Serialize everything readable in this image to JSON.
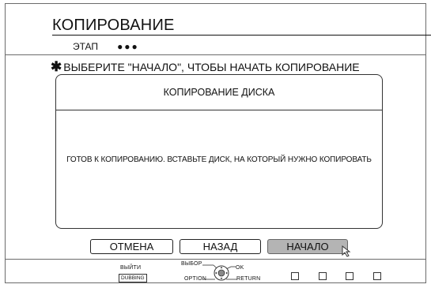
{
  "screen": {
    "title": "КОПИРОВАНИЕ",
    "step_label": "ЭТАП",
    "step_dots": "●●●",
    "instruction": "ВЫБЕРИТЕ \"НАЧАЛО\", ЧТОБЫ НАЧАТЬ КОПИРОВАНИЕ",
    "instruction_mark": "✱"
  },
  "dialog": {
    "title": "КОПИРОВАНИЕ ДИСКА",
    "message": "ГОТОВ К КОПИРОВАНИЮ. ВСТАВЬТЕ ДИСК, НА КОТОРЫЙ НУЖНО КОПИРОВАТЬ"
  },
  "buttons": {
    "cancel": "ОТМЕНА",
    "back": "НАЗАД",
    "start": "НАЧАЛО"
  },
  "footer": {
    "exit_label": "ВЫЙТИ",
    "dubbing_key": "DUBBING",
    "select_label": "ВЫБОР",
    "ok_label": "OK",
    "option_label": "OPTION",
    "return_label": "RETURN"
  },
  "colors": {
    "border": "#6b6b6b",
    "selected_button": "#b4b4b4"
  }
}
